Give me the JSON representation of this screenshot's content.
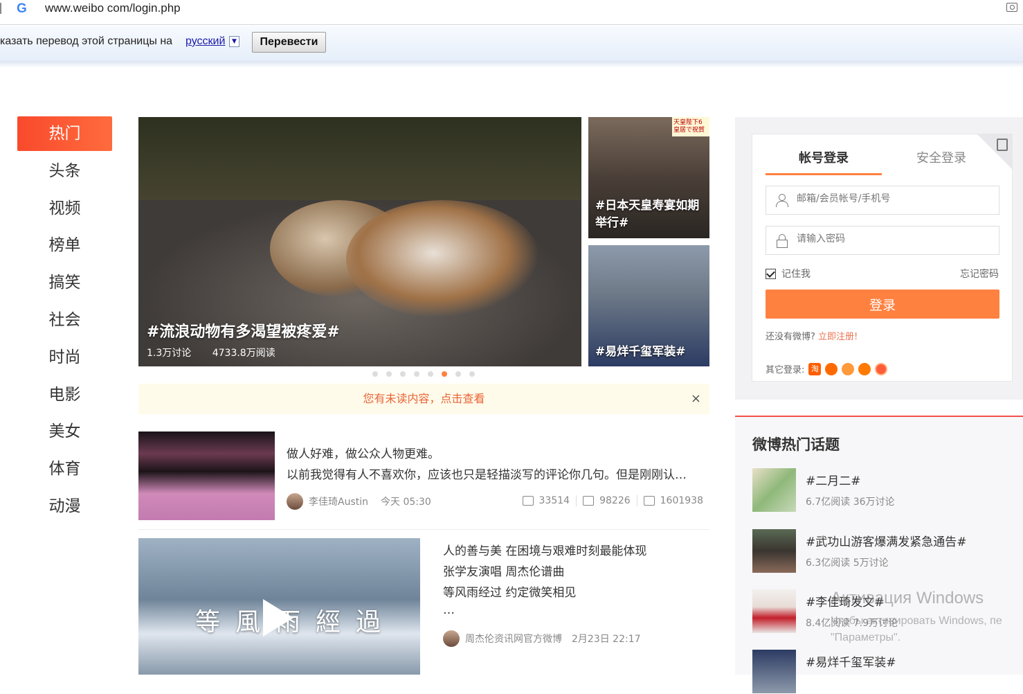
{
  "browser": {
    "url": "www.weibo com/login.php",
    "translate_prompt": "казать перевод этой страницы на",
    "translate_lang": "русский",
    "translate_button": "Перевести"
  },
  "nav": {
    "items": [
      "热门",
      "头条",
      "视频",
      "榜单",
      "搞笑",
      "社会",
      "时尚",
      "电影",
      "美女",
      "体育",
      "动漫"
    ]
  },
  "hero": {
    "title": "#流浪动物有多渴望被疼爱#",
    "discuss": "1.3万讨论",
    "reads": "4733.8万阅读"
  },
  "side_cards": [
    {
      "title": "#日本天皇寿宴如期举行#",
      "badge": "天皇陛下6 皇居で祝賀"
    },
    {
      "title": "#易烊千玺军装#"
    }
  ],
  "carousel": {
    "active_index": 5,
    "count": 8
  },
  "unread": {
    "text": "您有未读内容，点击查看",
    "close": "×"
  },
  "feed": [
    {
      "line1": "做人好难，做公众人物更难。",
      "line2": "以前我觉得有人不喜欢你，应该也只是轻描淡写的评论你几句。但是刚刚认…",
      "author": "李佳琦Austin",
      "time": "今天 05:30",
      "reposts": "33514",
      "comments": "98226",
      "likes": "1601938"
    },
    {
      "lines": [
        "人的善与美 在困境与艰难时刻最能体现",
        "张学友演唱 周杰伦谱曲",
        "等风雨经过 约定微笑相见",
        "…"
      ],
      "video_text": "等風雨經過",
      "author": "周杰伦资讯网官方微博",
      "time": "2月23日 22:17"
    }
  ],
  "login": {
    "tab_account": "帐号登录",
    "tab_secure": "安全登录",
    "username_placeholder": "邮箱/会员帐号/手机号",
    "password_placeholder": "请输入密码",
    "remember": "记住我",
    "forgot": "忘记密码",
    "submit": "登录",
    "no_account": "还没有微博?",
    "register": "立即注册!",
    "other_login": "其它登录:",
    "taobao_glyph": "淘"
  },
  "hot_topics": {
    "title": "微博热门话题",
    "items": [
      {
        "name": "#二月二#",
        "meta": "6.7亿阅读 36万讨论"
      },
      {
        "name": "#武功山游客爆满发紧急通告#",
        "meta": "6.3亿阅读 5万讨论"
      },
      {
        "name": "#李佳琦发文#",
        "meta": "8.4亿阅读 7.9万讨论"
      },
      {
        "name": "#易烊千玺军装#",
        "meta": ""
      }
    ]
  },
  "watermark": {
    "line1": "Активация Windows",
    "line2": "Чтобы активировать Windows, пе",
    "line3": "\"Параметры\"."
  },
  "colors": {
    "accent": "#ff8140",
    "nav_active": "#f94a2c",
    "hot_line": "#f3504a"
  }
}
